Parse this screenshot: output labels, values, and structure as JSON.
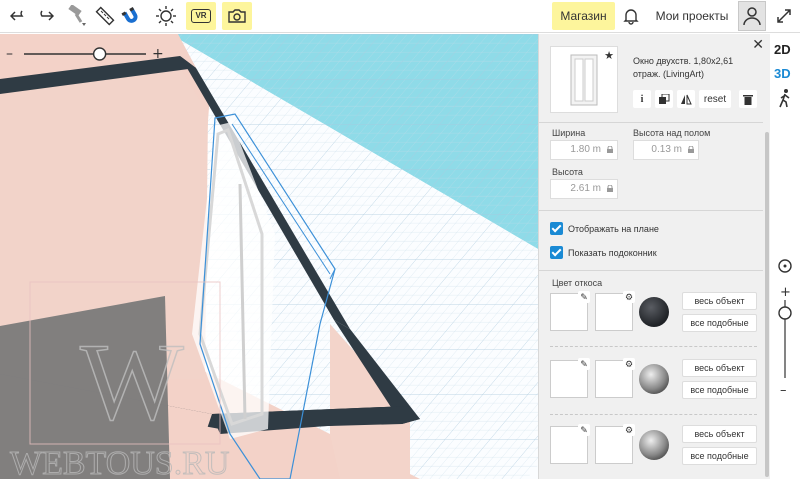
{
  "toolbar": {
    "undo_icon": "undo-icon",
    "redo_icon": "redo-icon",
    "brush_icon": "paint-roller-icon",
    "ruler_icon": "ruler-icon",
    "magnet_icon": "magnet-icon",
    "sun_icon": "sun-icon",
    "vr_label": "VR",
    "camera_icon": "camera-icon",
    "shop_label": "Магазин",
    "bell_icon": "bell-icon",
    "projects_label": "Мои проекты",
    "user_icon": "user-icon",
    "expand_icon": "expand-icon",
    "accent": "#fdf59c"
  },
  "zoom": {
    "minus": "–",
    "plus": "+",
    "level": 0.62
  },
  "panel": {
    "close": "✕",
    "object_title": "Окно двухств. 1,80х2,61 отраж. (LivingArt)",
    "favorite": "★",
    "actions": {
      "info": "i",
      "copy_icon": "duplicate-icon",
      "mirror_icon": "mirror-icon",
      "reset": "reset",
      "delete_icon": "trash-icon"
    },
    "width_label": "Ширина",
    "width_value": "1.80 m",
    "elevation_label": "Высота над полом",
    "elevation_value": "0.13 m",
    "height_label": "Высота",
    "height_value": "2.61 m",
    "show_on_plan": "Отображать на плане",
    "show_sill": "Показать подоконник",
    "slope_color_label": "Цвет откоса",
    "whole_object": "весь объект",
    "all_similar": "все подобные",
    "accent": "#1a8ad4"
  },
  "strip": {
    "mode_2d": "2D",
    "mode_3d": "3D",
    "walk_icon": "walk-icon",
    "plus": "+",
    "minus": "–"
  },
  "watermark": {
    "letter": "W",
    "text": "WEBTOUS.RU"
  }
}
